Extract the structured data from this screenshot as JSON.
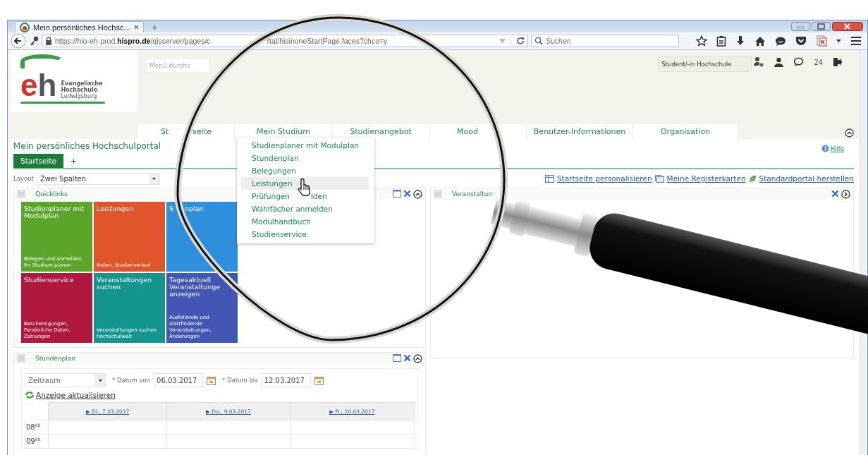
{
  "browser": {
    "tab_title": "Mein persönliches Hochsc...",
    "new_tab": "+",
    "url": "https://hio-eh-prod.**hispro.de**/qisserver/pages/c",
    "url_rest": "rtal/hisinoneStartPage.faces?chco=y",
    "search_placeholder": "Suchen"
  },
  "header": {
    "logo": {
      "letter_e": "e",
      "letter_h": "h",
      "name": "Evangelische Hochschule",
      "city": "Ludwigsburg"
    },
    "menu_search": {
      "placeholder": "Menü durchs"
    },
    "role": "Student/-in Hochschule",
    "notification_count": "24"
  },
  "navigation": [
    {
      "parts": [
        "St",
        "seite"
      ]
    },
    {
      "parts": [
        "Mein Studium"
      ],
      "menu": [
        {
          "parts": [
            "Studienplaner mit Modulplan"
          ],
          "selected": false
        },
        {
          "parts": [
            "Stundenplan"
          ],
          "selected": false
        },
        {
          "parts": [
            "Belegungen"
          ],
          "selected": false
        },
        {
          "parts": [
            "Leistungen"
          ],
          "selected": true
        },
        {
          "parts": [
            "Prüfungen",
            "lden"
          ],
          "selected": false
        },
        {
          "parts": [
            "Wahlfächer anmelden"
          ],
          "selected": false
        },
        {
          "parts": [
            "Modulhandbuch"
          ],
          "selected": false
        },
        {
          "parts": [
            "Studienservice"
          ],
          "selected": false
        }
      ]
    },
    {
      "parts": [
        "Studienangebot"
      ]
    },
    {
      "parts": [
        "Mood"
      ]
    },
    {
      "parts": [
        "Benutzer-Informationen"
      ]
    },
    {
      "parts": [
        "Organisation"
      ]
    }
  ],
  "portal": {
    "title": "Mein persönliches Hochschulportal",
    "help": "Hilfe",
    "tabs": [
      {
        "label": "Startseite",
        "selected": true
      },
      {
        "label": "+",
        "selected": false
      }
    ],
    "layout_label": "Layout",
    "layout_value": "Zwei Spalten",
    "actions": [
      {
        "kind": "personalize",
        "label": "Startseite personalisieren"
      },
      {
        "kind": "tabs",
        "label": "Meine Registerkarten"
      },
      {
        "kind": "reset",
        "label": "Standardportal herstellen"
      }
    ]
  },
  "quicklinks": {
    "title": "Quicklinks",
    "tiles": [
      {
        "title_parts": [
          "Studienplaner mit Modulplan"
        ],
        "caption": "Belegen und Anmelden, Ihr Studium planen",
        "color": "#5aa52a"
      },
      {
        "title_parts": [
          "Leistungen"
        ],
        "caption": "Noten, Studienverlauf",
        "color": "#e0552a"
      },
      {
        "title_parts": [
          "S",
          "nplan"
        ],
        "color": "#2e90dd"
      },
      {
        "title_parts": [
          "Studienservice"
        ],
        "caption": "Bescheinigungen, Persönliche Daten, Zahlungen",
        "color": "#b0183e"
      },
      {
        "title_parts": [
          "Veranstaltungen suchen"
        ],
        "caption": "Veranstaltungen suchen hochschulweit",
        "color": "#14968e"
      },
      {
        "title_parts": [
          "Tagesaktuell Veranstaltunge anzeigen"
        ],
        "caption": "Ausfallende und stattfindende Veranstaltungen, Änderungen",
        "color": "#4256b3"
      }
    ]
  },
  "events_portlet": {
    "title": "Veranstaltun"
  },
  "schedule": {
    "title": "Stundenplan",
    "period": "Zeitraum",
    "from_label": "* Datum von",
    "from": "06.03.2017",
    "to_label": "* Datum bis",
    "to": "12.03.2017",
    "refresh": "Anzeige aktualisieren",
    "days": [
      "▶ Di., 7.03.2017",
      "▶ Do., 9.03.2017",
      "▶ Fr., 10.03.2017"
    ],
    "hours": [
      "08$^{00}$",
      "09$^{00}$"
    ]
  }
}
